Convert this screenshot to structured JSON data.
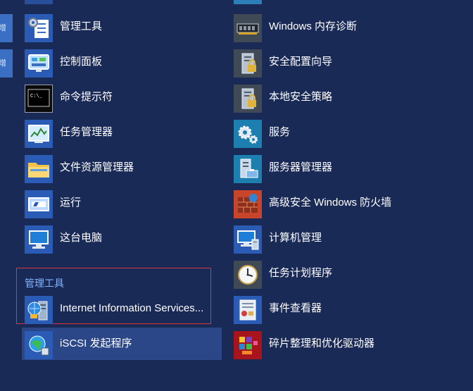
{
  "left_edge": {
    "tiles": [
      "增",
      "增"
    ]
  },
  "section": {
    "title": "管理工具"
  },
  "column1": [
    {
      "label": "管理工具",
      "icon": "admin-tools-icon"
    },
    {
      "label": "控制面板",
      "icon": "control-panel-icon"
    },
    {
      "label": "命令提示符",
      "icon": "command-prompt-icon"
    },
    {
      "label": "任务管理器",
      "icon": "task-manager-icon"
    },
    {
      "label": "文件资源管理器",
      "icon": "file-explorer-icon"
    },
    {
      "label": "运行",
      "icon": "run-icon"
    },
    {
      "label": "这台电脑",
      "icon": "this-pc-icon"
    }
  ],
  "section_items": [
    {
      "label": "Internet Information Services...",
      "icon": "iis-icon"
    },
    {
      "label": "iSCSI 发起程序",
      "icon": "iscsi-initiator-icon"
    }
  ],
  "column2": [
    {
      "label": "Windows 内存诊断",
      "icon": "memory-diagnostic-icon"
    },
    {
      "label": "安全配置向导",
      "icon": "security-wizard-icon"
    },
    {
      "label": "本地安全策略",
      "icon": "local-security-policy-icon"
    },
    {
      "label": "服务",
      "icon": "services-icon"
    },
    {
      "label": "服务器管理器",
      "icon": "server-manager-icon"
    },
    {
      "label": "高级安全 Windows 防火墙",
      "icon": "firewall-icon"
    },
    {
      "label": "计算机管理",
      "icon": "computer-management-icon"
    },
    {
      "label": "任务计划程序",
      "icon": "task-scheduler-icon"
    },
    {
      "label": "事件查看器",
      "icon": "event-viewer-icon"
    },
    {
      "label": "碎片整理和优化驱动器",
      "icon": "defragment-icon"
    }
  ]
}
